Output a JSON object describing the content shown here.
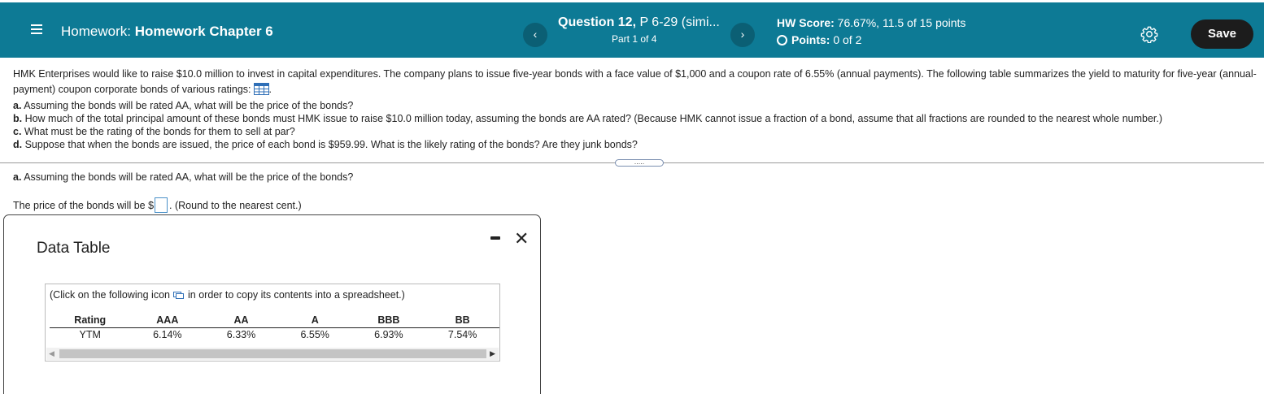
{
  "header": {
    "hw_prefix": "Homework:",
    "hw_name": "Homework Chapter 6",
    "question_number": "Question 12,",
    "question_ref": " P 6-29 (simi...",
    "part": "Part 1 of 4",
    "prev_symbol": "‹",
    "next_symbol": "›",
    "hw_score_label": "HW Score:",
    "hw_score_value": " 76.67%, 11.5 of 15 points",
    "points_label": "Points:",
    "points_value": " 0 of 2",
    "save_label": "Save",
    "bar_color": "#0d7a95"
  },
  "problem": {
    "intro": "HMK Enterprises would like to raise $10.0 million to invest in capital expenditures. The company plans to issue five-year bonds with a face value of $1,000 and a coupon rate of 6.55% (annual payments). The following table summarizes the yield to maturity for five-year (annual-payment) coupon corporate bonds of various ratings:",
    "intro_suffix": ".",
    "items": [
      {
        "label": "a.",
        "text": " Assuming the bonds will be rated AA, what will be the price of the bonds?"
      },
      {
        "label": "b.",
        "text": " How much of the total principal amount of these bonds must HMK issue to raise $10.0 million today, assuming the bonds are AA rated? (Because HMK cannot issue a fraction of a bond, assume that all fractions are rounded to the nearest whole number.)"
      },
      {
        "label": "c.",
        "text": " What must be the rating of the bonds for them to sell at par?"
      },
      {
        "label": "d.",
        "text": " Suppose that when the bonds are issued, the price of each bond is $959.99. What is the likely rating of the bonds? Are they junk bonds?"
      }
    ],
    "expander_label": "....."
  },
  "part_a": {
    "label": "a.",
    "question": " Assuming the bonds will be rated AA, what will be the price of the bonds?",
    "answer_prefix": "The price of the bonds will be $",
    "answer_value": "",
    "answer_suffix": ".  (Round to the nearest cent.)"
  },
  "data_table": {
    "title": "Data Table",
    "copy_note_prefix": "(Click on the following icon",
    "copy_note_suffix": "in order to copy its contents into a spreadsheet.)",
    "headers": [
      "Rating",
      "AAA",
      "AA",
      "A",
      "BBB",
      "BB"
    ],
    "row": [
      "YTM",
      "6.14%",
      "6.33%",
      "6.55%",
      "6.93%",
      "7.54%"
    ]
  }
}
